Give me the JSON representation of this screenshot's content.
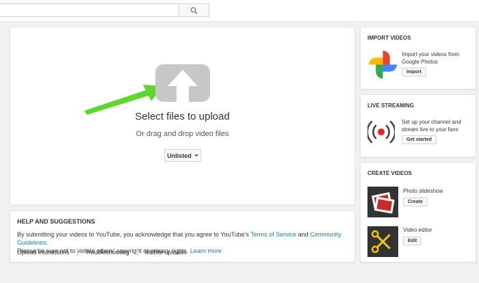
{
  "search": {
    "placeholder": ""
  },
  "upload": {
    "title": "Select files to upload",
    "subtitle": "Or drag and drop video files",
    "privacy": "Unlisted"
  },
  "help": {
    "title": "HELP AND SUGGESTIONS",
    "text_part1": "By submitting your videos to YouTube, you acknowledge that you agree to YouTube's ",
    "terms_link": "Terms of Service",
    "text_and": " and ",
    "guidelines_link": "Community Guidelines",
    "text_part2": ".",
    "text_part3": "Please be sure not to violate others' copyright or privacy rights. ",
    "learn_more": "Learn more",
    "links": [
      "Upload instructions",
      "Troubleshooting",
      "Mobile uploads"
    ]
  },
  "import": {
    "title": "IMPORT VIDEOS",
    "text": "Import your videos from Google Photos",
    "button": "Import",
    "icon": "google-photos-pinwheel"
  },
  "live": {
    "title": "LIVE STREAMING",
    "text": "Set up your channel and stream live to your fans",
    "button": "Get started",
    "icon": "live-broadcast"
  },
  "create": {
    "title": "CREATE VIDEOS",
    "items": [
      {
        "label": "Photo slideshow",
        "button": "Create",
        "icon": "photo-slideshow"
      },
      {
        "label": "Video editor",
        "button": "Edit",
        "icon": "scissors"
      }
    ]
  },
  "colors": {
    "accent_blue": "#167ac6",
    "upload_icon_gray": "#c7c7c7",
    "arrow_green": "#5fd62d",
    "live_red": "#e62117"
  }
}
